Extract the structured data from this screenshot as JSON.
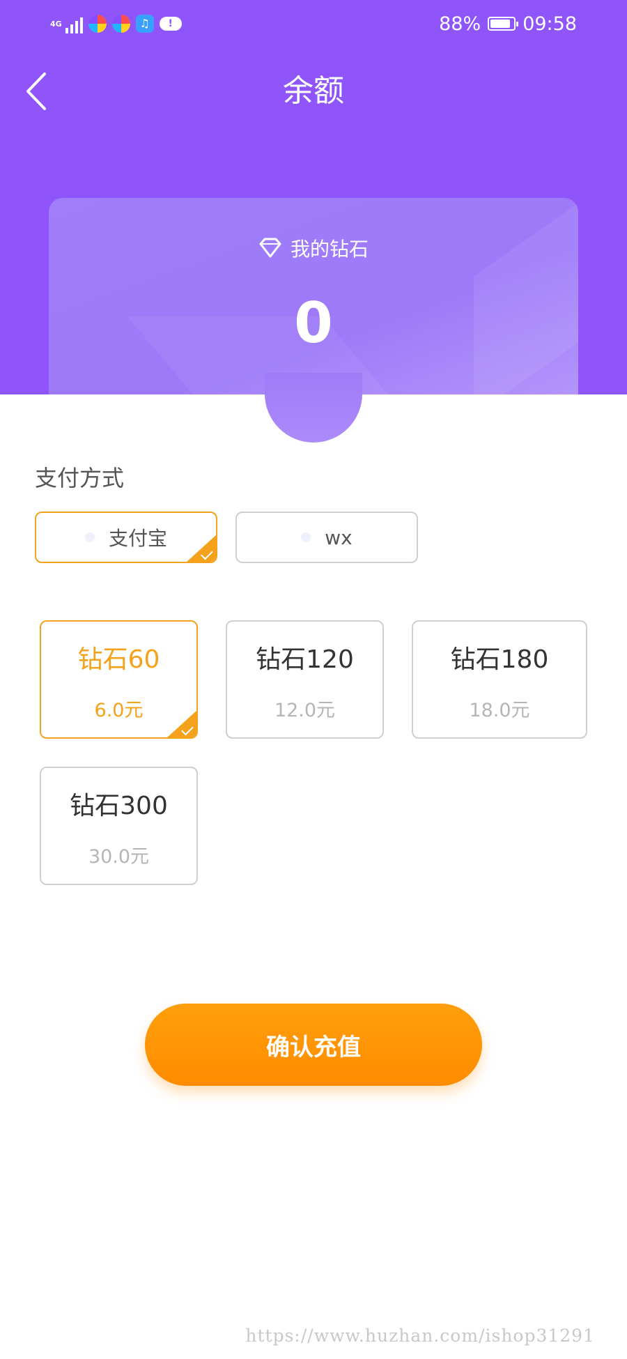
{
  "status_bar": {
    "network": "4G",
    "battery_percent": "88%",
    "battery_level": 0.88,
    "time": "09:58",
    "icons": [
      "signal-icon",
      "app-icon",
      "app-icon",
      "music-app-icon",
      "cloud-alert-icon"
    ]
  },
  "header": {
    "title": "余额",
    "back_icon": "chevron-left-icon"
  },
  "balance_card": {
    "label": "我的钻石",
    "value": "0",
    "icon": "diamond-icon"
  },
  "payment": {
    "label": "支付方式",
    "options": [
      {
        "label": "支付宝",
        "selected": true
      },
      {
        "label": "wx",
        "selected": false
      }
    ]
  },
  "packages": [
    {
      "name": "钻石60",
      "price": "6.0元",
      "selected": true
    },
    {
      "name": "钻石120",
      "price": "12.0元",
      "selected": false
    },
    {
      "name": "钻石180",
      "price": "18.0元",
      "selected": false
    },
    {
      "name": "钻石300",
      "price": "30.0元",
      "selected": false
    }
  ],
  "confirm_button": {
    "label": "确认充值"
  },
  "watermark": "https://www.huzhan.com/ishop31291",
  "colors": {
    "header_purple": "#8f55fa",
    "accent_orange": "#f4a21c",
    "button_orange": "#ff9100"
  }
}
